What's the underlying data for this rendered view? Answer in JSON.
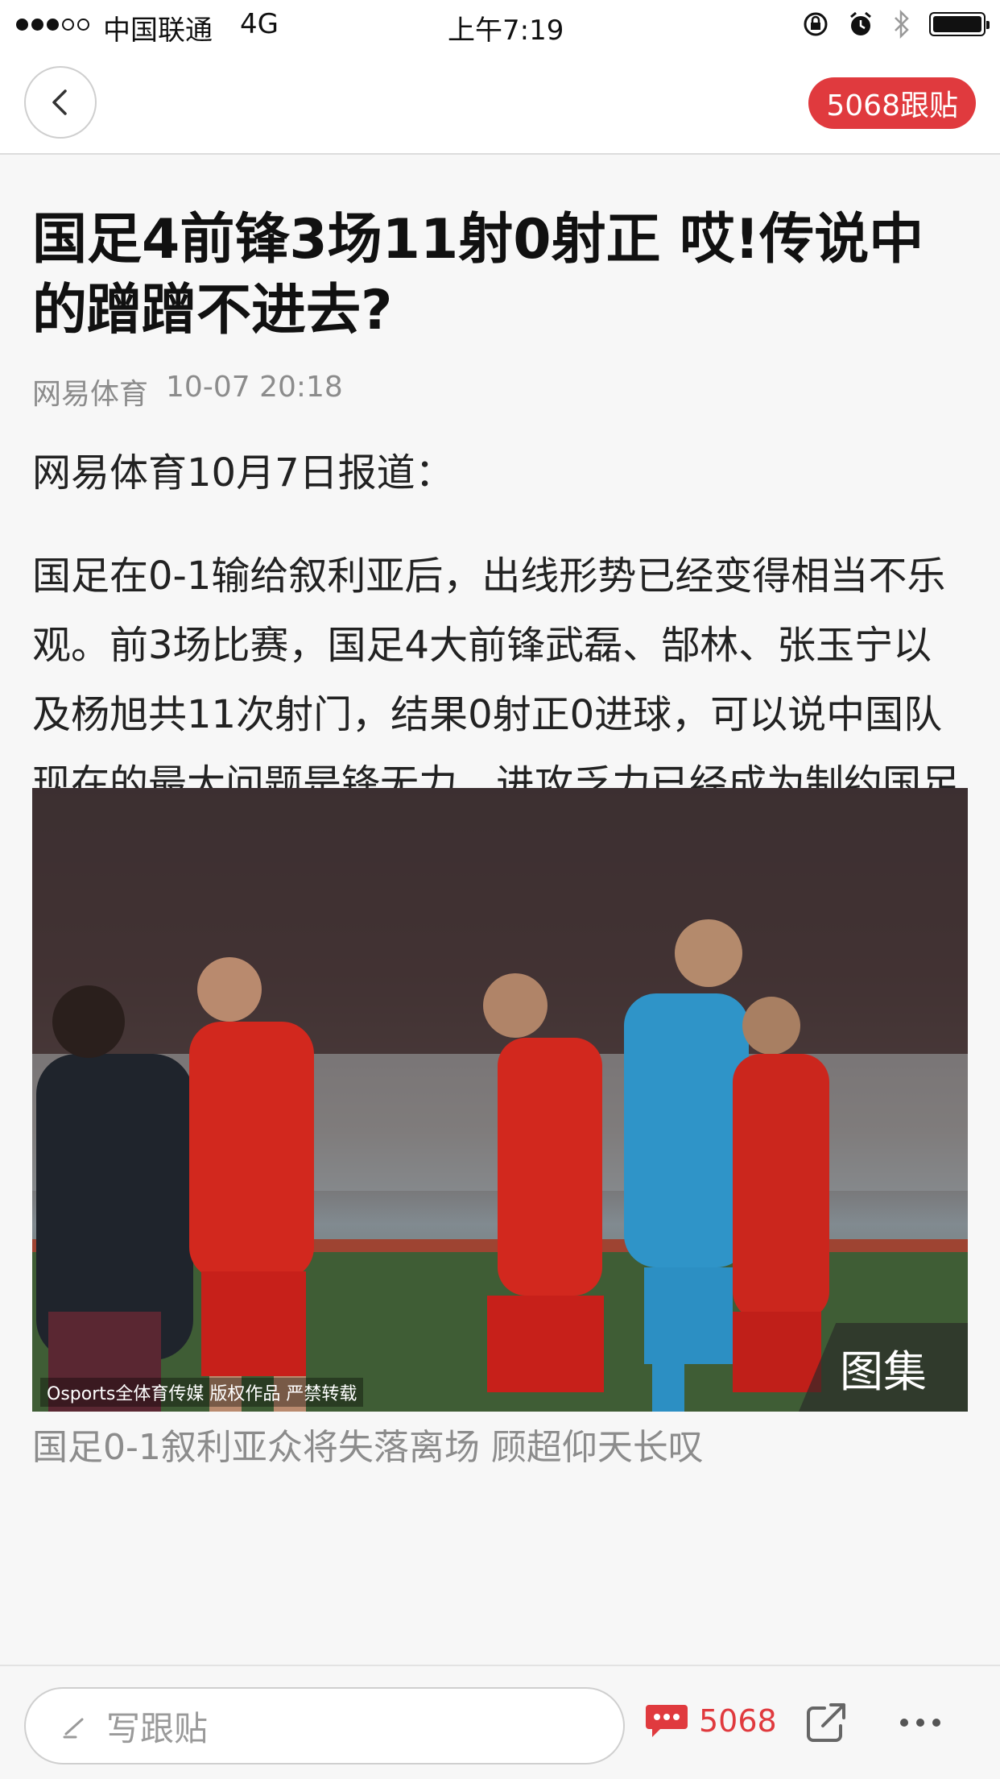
{
  "status_bar": {
    "signal_dots": [
      true,
      true,
      true,
      false,
      false
    ],
    "carrier": "中国联通",
    "network": "4G",
    "time": "上午7:19"
  },
  "nav": {
    "comments_label": "5068跟贴"
  },
  "article": {
    "title": "国足4前锋3场11射0射正 哎!传说中的蹭蹭不进去?",
    "source": "网易体育",
    "datetime": "10-07 20:18",
    "intro": "网易体育10月7日报道：",
    "body": "国足在0-1输给叙利亚后，出线形势已经变得相当不乐观。前3场比赛，国足4大前锋武磊、郜林、张玉宁以及杨旭共11次射门，结果0射正0进球，可以说中国队现在的最大问题是锋无力，进攻乏力已经成为制约国足走远的绊脚石。",
    "photo": {
      "watermark": "Osports全体育传媒 版权作品 严禁转载",
      "gallery_label": "图集",
      "caption": "国足0-1叙利亚众将失落离场 顾超仰天长叹"
    }
  },
  "toolbar": {
    "reply_placeholder": "写跟贴",
    "comment_count": "5068"
  },
  "colors": {
    "accent": "#e03a3e",
    "muted_text": "#8c8c8c"
  }
}
